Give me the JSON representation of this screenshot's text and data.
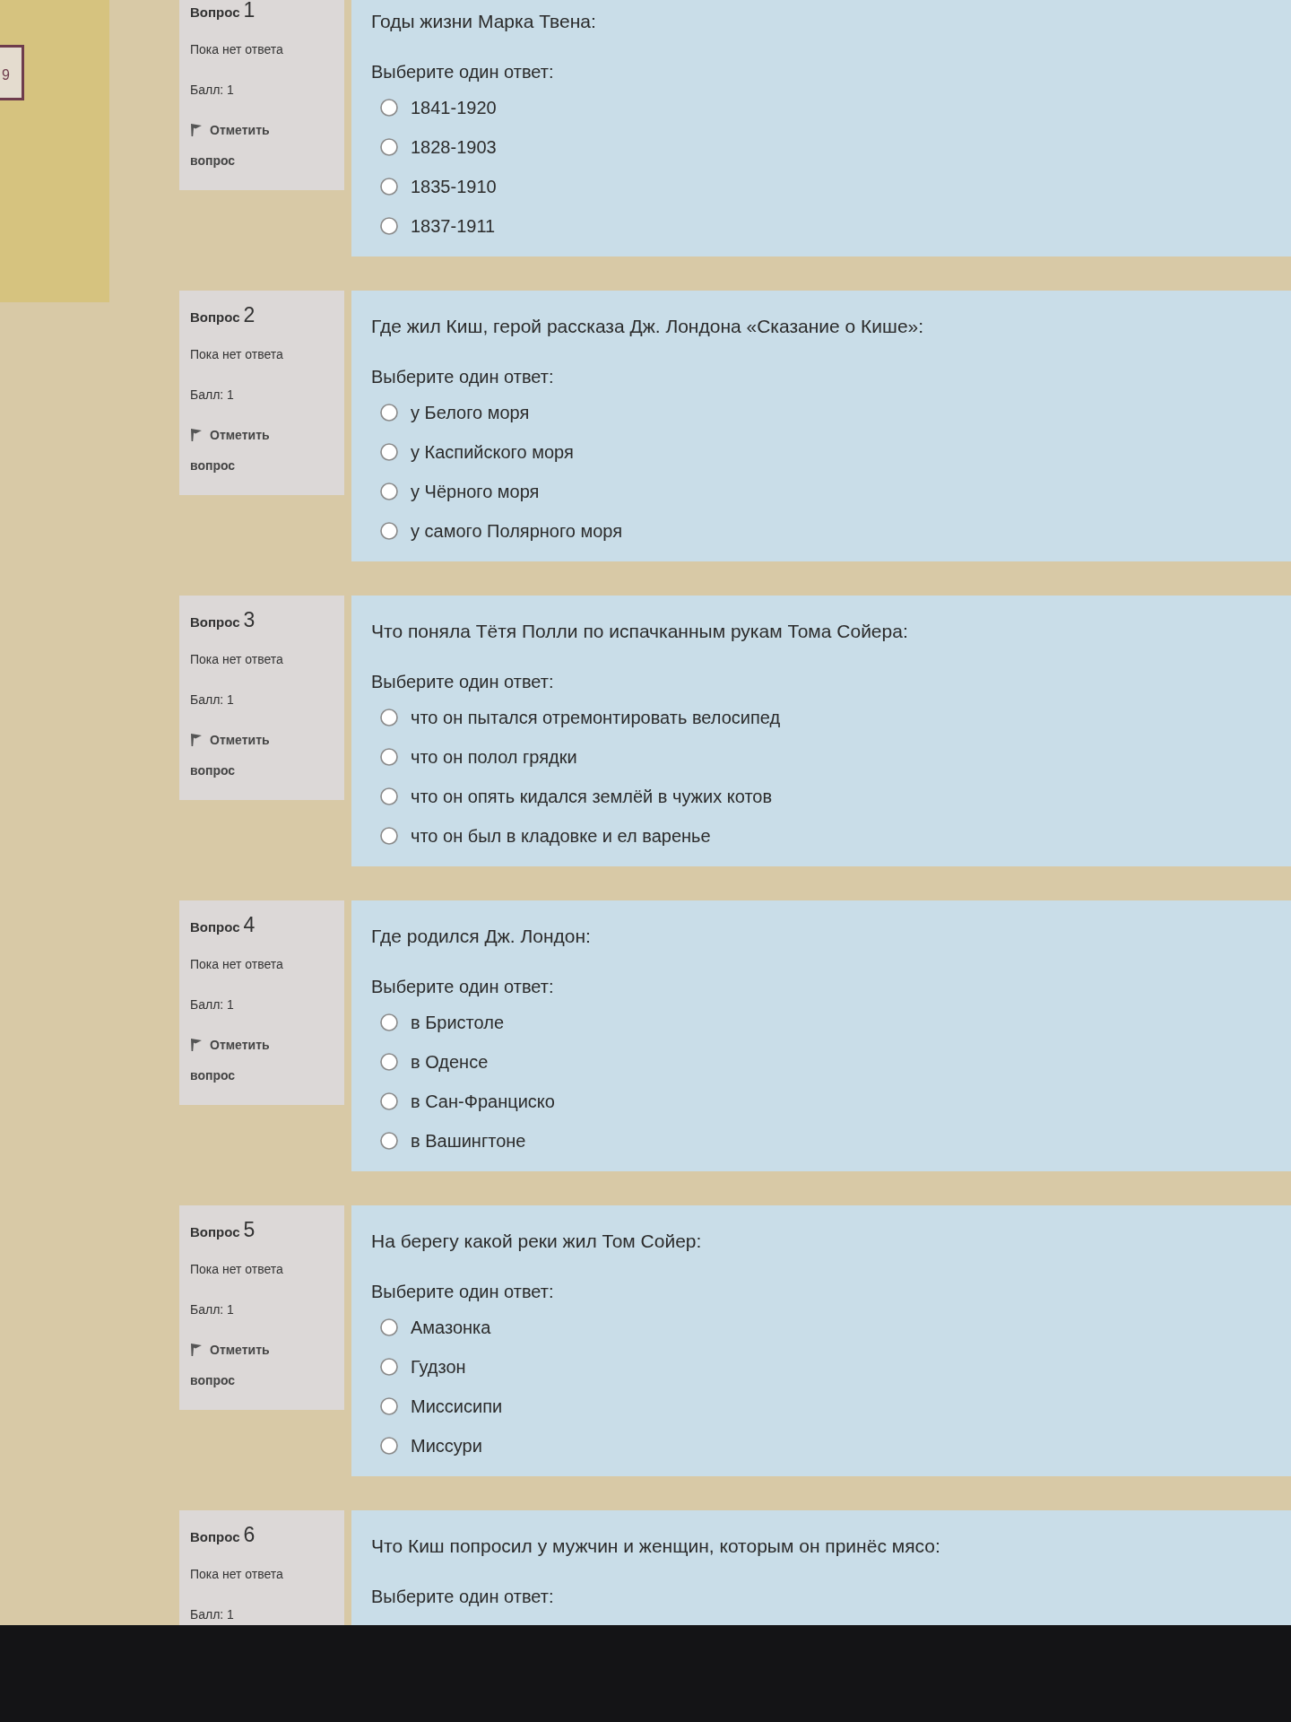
{
  "quiz_navigation": {
    "buttons": [
      {
        "label": "9"
      }
    ]
  },
  "questions": [
    {
      "title": "Вопрос",
      "number": "1",
      "status": "Пока нет ответа",
      "mark": "Балл: 1",
      "flag_link": "Отметить вопрос",
      "prompt": "Годы жизни Марка Твена:",
      "instruction": "Выберите один ответ:",
      "options": [
        {
          "label": "1841-1920",
          "selected": false
        },
        {
          "label": "1828-1903",
          "selected": false
        },
        {
          "label": "1835-1910",
          "selected": false
        },
        {
          "label": "1837-1911",
          "selected": false
        }
      ]
    },
    {
      "title": "Вопрос",
      "number": "2",
      "status": "Пока нет ответа",
      "mark": "Балл: 1",
      "flag_link": "Отметить вопрос",
      "prompt": "Где жил Киш, герой рассказа Дж. Лондона «Сказание о Кише»:",
      "instruction": "Выберите один ответ:",
      "options": [
        {
          "label": "у Белого моря",
          "selected": false
        },
        {
          "label": "у Каспийского моря",
          "selected": false
        },
        {
          "label": "у Чёрного моря",
          "selected": false
        },
        {
          "label": "у самого Полярного моря",
          "selected": false
        }
      ]
    },
    {
      "title": "Вопрос",
      "number": "3",
      "status": "Пока нет ответа",
      "mark": "Балл: 1",
      "flag_link": "Отметить вопрос",
      "prompt": "Что поняла Тётя Полли по испачканным рукам Тома Сойера:",
      "instruction": "Выберите один ответ:",
      "options": [
        {
          "label": "что он пытался отремонтировать велосипед",
          "selected": false
        },
        {
          "label": "что он полол грядки",
          "selected": false
        },
        {
          "label": "что он опять кидался землёй в чужих котов",
          "selected": false
        },
        {
          "label": "что он был в кладовке и ел варенье",
          "selected": false
        }
      ]
    },
    {
      "title": "Вопрос",
      "number": "4",
      "status": "Пока нет ответа",
      "mark": "Балл: 1",
      "flag_link": "Отметить вопрос",
      "prompt": "Где родился Дж. Лондон:",
      "instruction": "Выберите один ответ:",
      "options": [
        {
          "label": "в Бристоле",
          "selected": false
        },
        {
          "label": "в Оденсе",
          "selected": false
        },
        {
          "label": "в Сан-Франциско",
          "selected": false
        },
        {
          "label": "в Вашингтоне",
          "selected": false
        }
      ]
    },
    {
      "title": "Вопрос",
      "number": "5",
      "status": "Пока нет ответа",
      "mark": "Балл: 1",
      "flag_link": "Отметить вопрос",
      "prompt": "На берегу какой реки жил Том Сойер:",
      "instruction": "Выберите один ответ:",
      "options": [
        {
          "label": "Амазонка",
          "selected": false
        },
        {
          "label": "Гудзон",
          "selected": false
        },
        {
          "label": "Миссисипи",
          "selected": false
        },
        {
          "label": "Миссури",
          "selected": false
        }
      ]
    },
    {
      "title": "Вопрос",
      "number": "6",
      "status": "Пока нет ответа",
      "mark": "Балл: 1",
      "prompt": "Что Киш попросил у мужчин и женщин, которым он принёс мясо:",
      "instruction": "Выберите один ответ:"
    }
  ]
}
